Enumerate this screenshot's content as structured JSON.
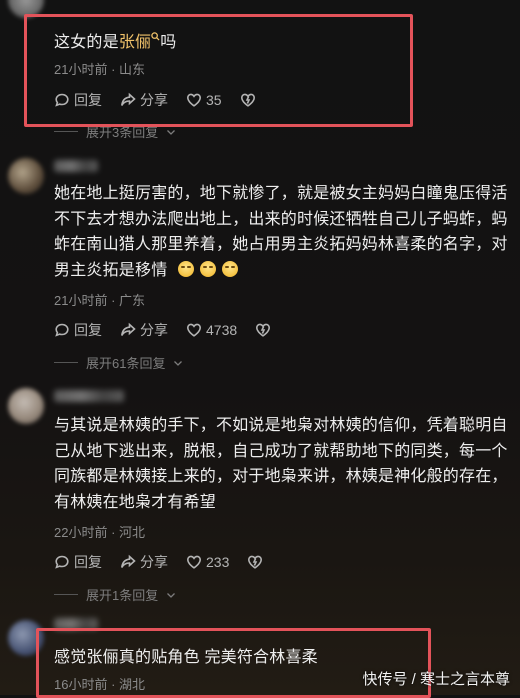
{
  "comments": [
    {
      "text_prefix": "这女的是",
      "text_link": "张俪",
      "text_suffix": "吗",
      "time": "21小时前",
      "location": "山东",
      "reply_label": "回复",
      "share_label": "分享",
      "likes": "35",
      "expand_label": "展开3条回复"
    },
    {
      "text": "她在地上挺厉害的，地下就惨了，就是被女主妈妈白瞳鬼压得活不下去才想办法爬出地上，出来的时候还牺牲自己儿子蚂蚱，蚂蚱在南山猎人那里养着，她占用男主炎拓妈妈林喜柔的名字，对男主炎拓是移情",
      "time": "21小时前",
      "location": "广东",
      "reply_label": "回复",
      "share_label": "分享",
      "likes": "4738",
      "expand_label": "展开61条回复"
    },
    {
      "text": "与其说是林姨的手下，不如说是地枭对林姨的信仰，凭着聪明自己从地下逃出来，脱根，自己成功了就帮助地下的同类，每一个同族都是林姨接上来的，对于地枭来讲，林姨是神化般的存在，有林姨在地枭才有希望",
      "time": "22小时前",
      "location": "河北",
      "reply_label": "回复",
      "share_label": "分享",
      "likes": "233",
      "expand_label": "展开1条回复"
    },
    {
      "text": "感觉张俪真的贴角色 完美符合林喜柔",
      "time": "16小时前",
      "location": "湖北"
    }
  ],
  "meta_separator": " · ",
  "watermark": "快传号 / 寒士之言本尊",
  "colors": {
    "highlight": "#e3535a",
    "link": "#f0c26a",
    "background": "#121212"
  },
  "icons": [
    "reply-icon",
    "share-icon",
    "like-icon",
    "dislike-icon",
    "search-icon",
    "chevron-down-icon"
  ]
}
